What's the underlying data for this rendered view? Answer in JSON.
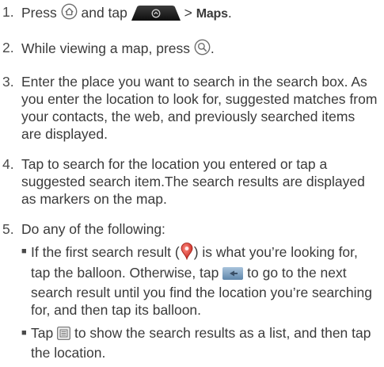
{
  "steps": [
    {
      "number": "1.",
      "press": "Press",
      "and_tap": "and tap",
      "arrow": ">",
      "maps": "Maps",
      "end": "."
    },
    {
      "number": "2.",
      "text": "While viewing a map, press",
      "end": "."
    },
    {
      "number": "3.",
      "text": "Enter the place you want to search in the search box. As you enter the location to look for, suggested matches from your contacts, the web, and previously searched items are displayed."
    },
    {
      "number": "4.",
      "text": "Tap to search for the location you entered or tap a suggested search item.The search results are displayed as markers on the map."
    },
    {
      "number": "5.",
      "text": "Do any of the following:"
    }
  ],
  "bullets": [
    {
      "marker": "■",
      "text_a": "If the first search result (",
      "text_b": ") is what you’re looking for, tap the balloon. Otherwise, tap",
      "text_c": "to go to the next search result until you find the location you’re searching for, and then tap its balloon."
    },
    {
      "marker": "■",
      "text_a": "Tap",
      "text_b": "to show the search results as a list, and then tap the location."
    }
  ],
  "icons": {
    "home": "home-key-icon",
    "all_apps": "all-apps-tab-icon",
    "search_key": "search-key-icon",
    "marker": "map-marker-icon",
    "next_arrow": "next-arrow-button-icon",
    "list": "list-view-icon"
  },
  "colors": {
    "text": "#3a3a3a",
    "icon_gray": "#6e6e6e",
    "marker_red": "#d9342b"
  }
}
